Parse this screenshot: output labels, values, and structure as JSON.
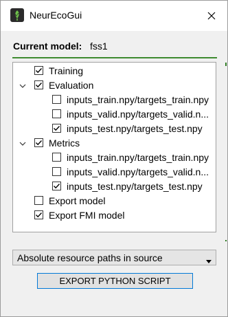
{
  "window": {
    "title": "NeurEcoGui",
    "close_icon": "close-icon",
    "app_icon": "neurecogui-logo-icon"
  },
  "header": {
    "model_label": "Current model:",
    "model_value": "fss1",
    "accent_color": "#3d8a2f"
  },
  "tree": {
    "items": [
      {
        "label": "Training",
        "checked": true,
        "expandable": false
      },
      {
        "label": "Evaluation",
        "checked": true,
        "expandable": true,
        "expanded": true
      },
      {
        "label": "inputs_train.npy/targets_train.npy",
        "checked": false
      },
      {
        "label": "inputs_valid.npy/targets_valid.n...",
        "checked": false
      },
      {
        "label": "inputs_test.npy/targets_test.npy",
        "checked": true
      },
      {
        "label": "Metrics",
        "checked": true,
        "expandable": true,
        "expanded": true
      },
      {
        "label": "inputs_train.npy/targets_train.npy",
        "checked": false
      },
      {
        "label": "inputs_valid.npy/targets_valid.n...",
        "checked": false
      },
      {
        "label": "inputs_test.npy/targets_test.npy",
        "checked": true
      },
      {
        "label": "Export model",
        "checked": false
      },
      {
        "label": "Export FMI model",
        "checked": true
      }
    ]
  },
  "paths_select": {
    "selected": "Absolute resource paths in source"
  },
  "export_button": {
    "label": "EXPORT PYTHON SCRIPT",
    "focus_color": "#0078d7"
  }
}
